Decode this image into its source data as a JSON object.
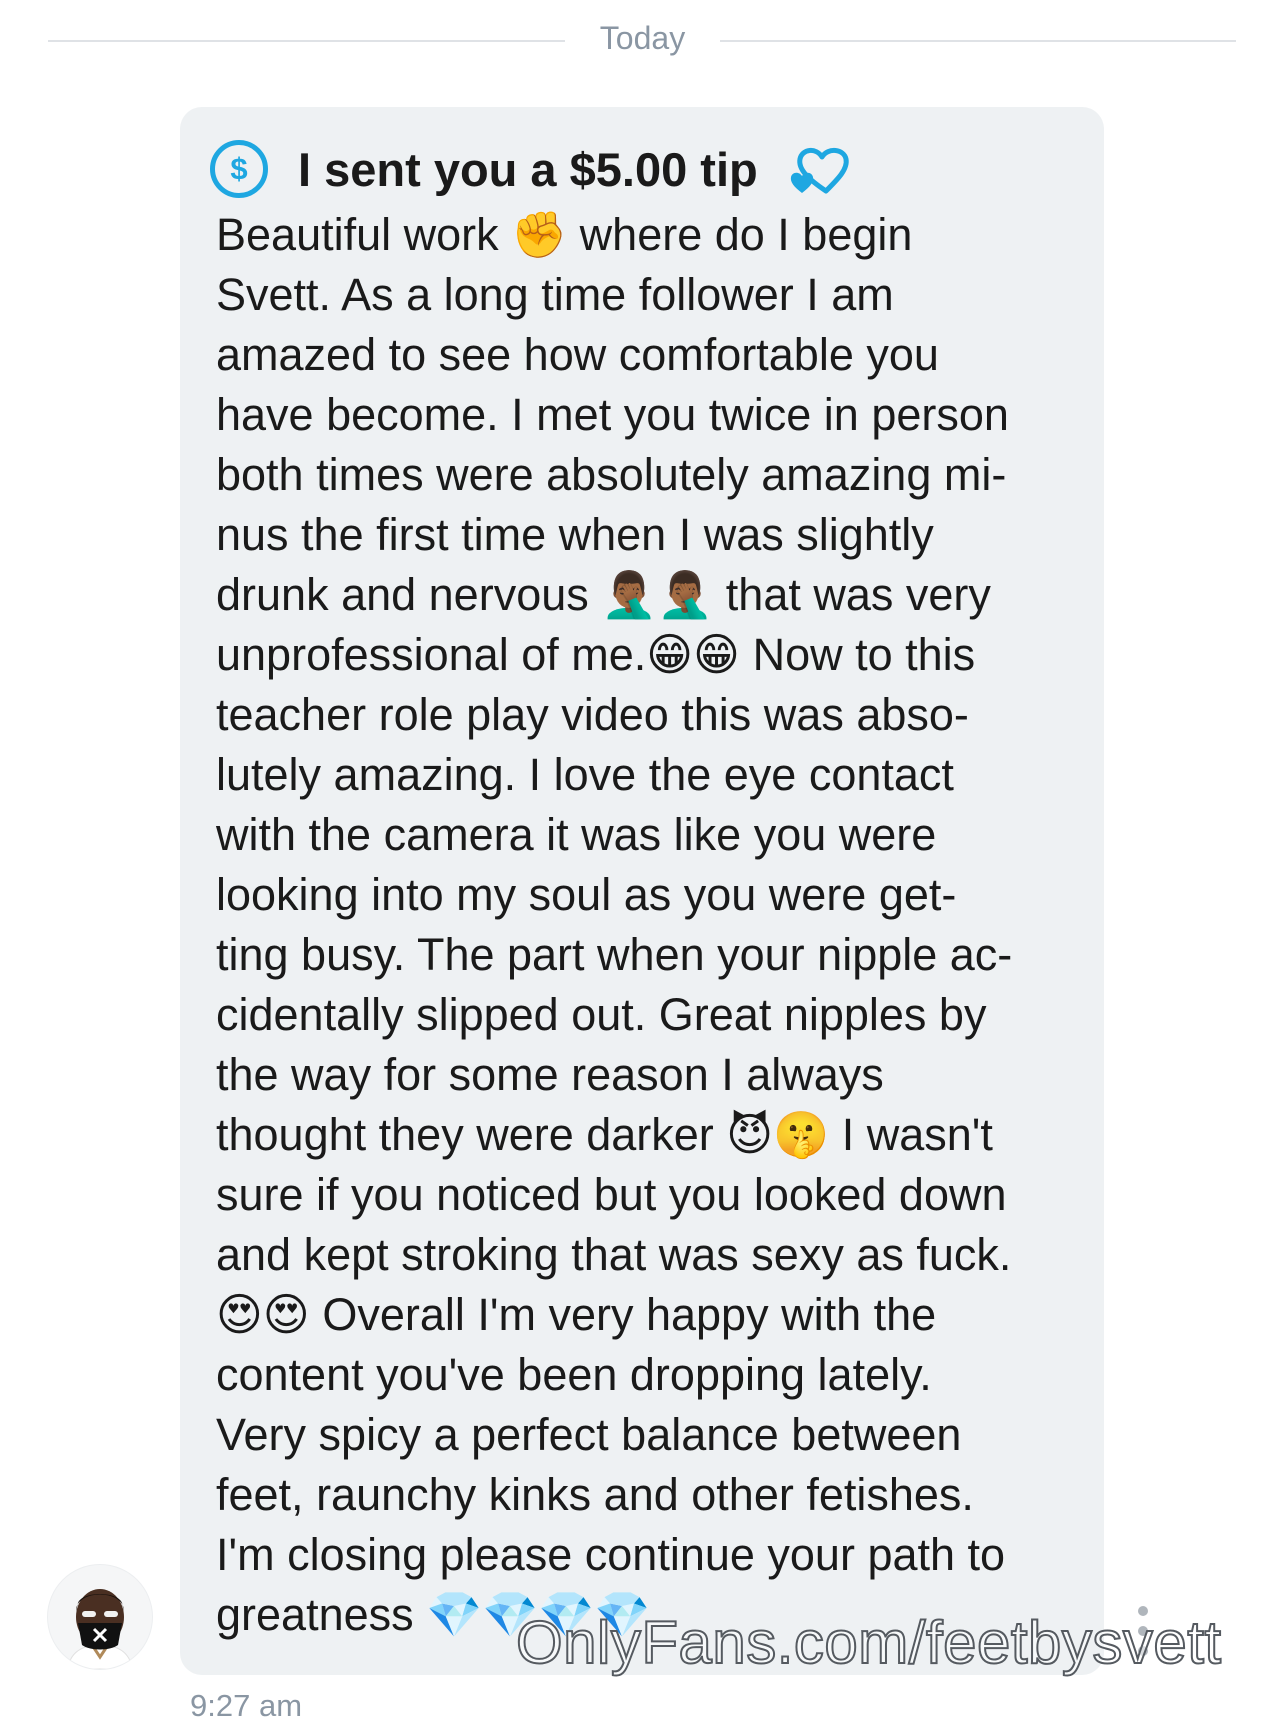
{
  "date_divider": {
    "label": "Today"
  },
  "message": {
    "tip_header": "I sent you a $5.00 tip",
    "tip_icon": "dollar-circle-icon",
    "heart_icon": "twin-hearts-icon",
    "body": "Beautiful work ✊ where do I begin\nSvett. As a long time follower I am\namazed to see how comfortable you\nhave become. I met you twice in person\nboth times were absolutely amazing mi-\nnus the first time when I was slightly\ndrunk and nervous 🤦🏾‍♂️🤦🏾‍♂️ that was very\nunprofessional of me.😁😁 Now to this\nteacher role play video this was abso-\nlutely amazing. I love the eye contact\nwith the camera it was like you were\nlooking into my soul as you were get-\nting busy. The part when your nipple ac-\ncidentally slipped out. Great nipples by\nthe way for some reason I always\nthought they were darker 😈🤫 I wasn't\nsure if you noticed but you looked down\nand kept stroking that was sexy as fuck.\n😍😍 Overall I'm very happy with the\ncontent you've been dropping lately.\nVery spicy a perfect balance between\nfeet, raunchy kinks and other fetishes.\nI'm closing please continue your path to\ngreatness 💎💎💎💎",
    "timestamp": "9:27 am"
  },
  "sender": {
    "avatar": "bitmoji-avatar"
  },
  "watermark": {
    "text": "OnlyFans.com/feetbysvett"
  },
  "colors": {
    "accent": "#1ea7e1",
    "bubble_bg": "#eef1f3",
    "muted_text": "#8a96a3",
    "divider": "#dfe2e6"
  }
}
